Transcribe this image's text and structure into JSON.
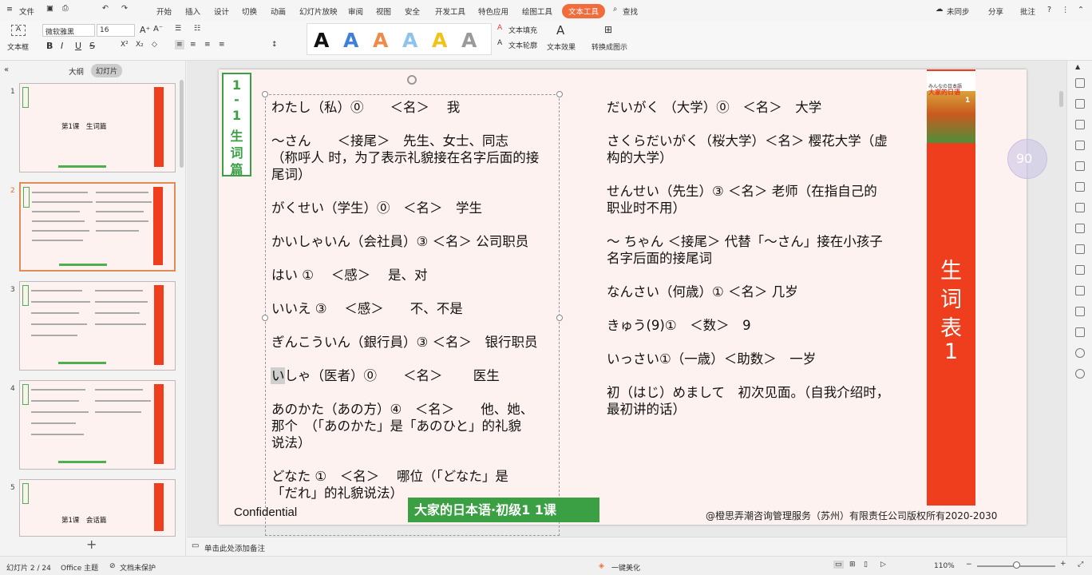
{
  "menu": {
    "file": "文件",
    "tabs": [
      "开始",
      "插入",
      "设计",
      "切换",
      "动画",
      "幻灯片放映",
      "审阅",
      "视图",
      "安全",
      "开发工具",
      "特色应用",
      "绘图工具",
      "文本工具"
    ],
    "search": "查找",
    "right": {
      "sync": "未同步",
      "share": "分享",
      "comment": "批注"
    }
  },
  "ribbon": {
    "textbox": "文本框",
    "font_name": "微软雅黑",
    "font_size": "16",
    "bold": "B",
    "italic": "I",
    "underline": "U",
    "strike": "S",
    "fill": "文本填充",
    "outline": "文本轮廓",
    "effect": "文本效果",
    "convert": "转换成图示",
    "style_letter": "A",
    "style_colors": [
      "#111111",
      "#3f7fd9",
      "#f08a4b",
      "#8fc3ec",
      "#f3c218",
      "#9a9a9a"
    ]
  },
  "left_panel": {
    "tab_outline": "大纲",
    "tab_slides": "幻灯片",
    "slides": [
      {
        "num": "1",
        "title": "第1课　生词篇"
      },
      {
        "num": "2",
        "title": ""
      },
      {
        "num": "3",
        "title": ""
      },
      {
        "num": "4",
        "title": ""
      },
      {
        "num": "5",
        "title": "第1课　会话篇"
      }
    ]
  },
  "slide": {
    "side_label": [
      "1",
      "-",
      "1",
      "生",
      "词",
      "篇"
    ],
    "left_items": [
      "わたし（私）⓪　　＜名＞　 我",
      "～さん　　＜接尾＞　先生、女士、同志",
      "（称呼人 时，为了表示礼貌接在名字后面的接",
      "尾词）",
      "がくせい（学生）⓪　＜名＞　学生",
      "かいしゃいん（会社員）③ ＜名＞ 公司职员",
      "はい ①　 ＜感＞　 是、对",
      "いいえ ③　 ＜感＞　　不、不是",
      "ぎんこういん（銀行員）③ ＜名＞　银行职员",
      "いしゃ（医者）⓪　　＜名＞　　 医生",
      "あのかた（あの方）④　＜名＞　　他、她、",
      "那个　（「あのかた」是「あのひと」的礼貌",
      "说法）",
      "どなた ①　＜名＞　 哪位（「どなた」是",
      "「だれ」的礼貌说法）"
    ],
    "right_items": [
      "だいがく （大学）⓪　＜名＞　大学",
      "さくらだいがく（桜大学）＜名＞ 樱花大学（虚",
      "构的大学）",
      "せんせい（先生）③ ＜名＞ 老师（在指自己的",
      "职业时不用）",
      "～ ちゃん ＜接尾＞ 代替「～さん」接在小孩子",
      "名字后面的接尾词",
      "なんさい（何歳）① ＜名＞ 几岁",
      "きゅう(9)①　＜数＞　9",
      "いっさい①（一歳）＜助数＞　一岁",
      "初（はじ）めまして　初次见面。（自我介绍时，",
      "最初讲的话）"
    ],
    "vertical_title": [
      "生",
      "词",
      "表",
      "1"
    ],
    "book": {
      "line1": "みんなの日本語",
      "line2": "大家的日语",
      "num": "1"
    },
    "footer_left": "Confidential",
    "footer_center": "大家的日本语·初级1 1课",
    "footer_right": "@橙思弄潮咨询管理服务（苏州）有限责任公司版权所有2020-2030",
    "overlay_percent": "90"
  },
  "notes": {
    "placeholder": "单击此处添加备注"
  },
  "status": {
    "slide_info": "幻灯片 2 / 24",
    "theme": "Office 主题",
    "protect": "文档未保护",
    "beautify": "一键美化",
    "zoom": "110%"
  },
  "colors": {
    "accent": "#f26b3a",
    "brand_red": "#ee3e1e",
    "green": "#3aa043"
  }
}
